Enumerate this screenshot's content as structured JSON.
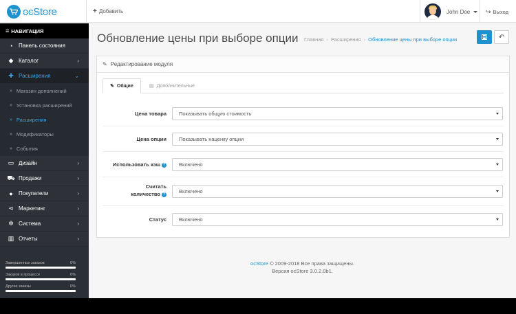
{
  "header": {
    "logo_text": "ocStore",
    "add_label": "Добавить",
    "user_name": "John Doe",
    "logout_label": "Выход"
  },
  "sidebar": {
    "nav_title": "НАВИГАЦИЯ",
    "items": [
      {
        "label": "Панель состояния",
        "icon": "dashboard-icon",
        "chevron": false
      },
      {
        "label": "Каталог",
        "icon": "tag-icon",
        "chevron": true
      },
      {
        "label": "Расширения",
        "icon": "puzzle-icon",
        "chevron": true,
        "active": true
      },
      {
        "label": "Дизайн",
        "icon": "monitor-icon",
        "chevron": true
      },
      {
        "label": "Продажи",
        "icon": "cart-icon",
        "chevron": true
      },
      {
        "label": "Покупатели",
        "icon": "user-icon",
        "chevron": true
      },
      {
        "label": "Маркетинг",
        "icon": "share-icon",
        "chevron": true
      },
      {
        "label": "Система",
        "icon": "cog-icon",
        "chevron": true
      },
      {
        "label": "Отчеты",
        "icon": "bar-chart-icon",
        "chevron": true
      }
    ],
    "sub_items": [
      {
        "label": "Магазин дополнений"
      },
      {
        "label": "Установка расширений"
      },
      {
        "label": "Расширения",
        "current": true
      },
      {
        "label": "Модификаторы"
      },
      {
        "label": "События"
      }
    ],
    "stats": [
      {
        "label": "Завершенных заказов",
        "value": "0%"
      },
      {
        "label": "Заказов в процессе",
        "value": "0%"
      },
      {
        "label": "Другие заказы",
        "value": "0%"
      }
    ]
  },
  "main": {
    "title": "Обновление цены при выборе опции",
    "breadcrumb": [
      "Главная",
      "Расширения",
      "Обновление цены при выборе опции"
    ],
    "panel_title": "Редактирование модуля",
    "tabs": [
      {
        "label": "Общие",
        "active": true
      },
      {
        "label": "Дополнительные",
        "active": false
      }
    ],
    "fields": [
      {
        "label": "Цена товара",
        "value": "Показывать общую стоимость",
        "help": false
      },
      {
        "label": "Цена опции",
        "value": "Показывать наценку опции",
        "help": false
      },
      {
        "label": "Использовать кэш",
        "value": "Включено",
        "help": true
      },
      {
        "label": "Считать количество",
        "value": "Включено",
        "help": true
      },
      {
        "label": "Статус",
        "value": "Включено",
        "help": false
      }
    ]
  },
  "footer": {
    "brand": "ocStore",
    "copyright": "© 2009-2018 Все права защищены.",
    "version": "Версия ocStore 3.0.2.0b1."
  },
  "colors": {
    "accent": "#1e91cf",
    "sidebar_bg": "#2b2f36",
    "nav_head_bg": "#000000"
  }
}
